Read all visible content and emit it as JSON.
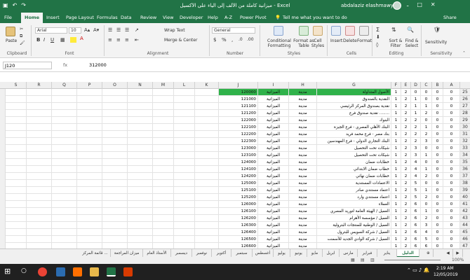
{
  "window": {
    "title": "ميزانية كاملة من الألف إلى الياء على الأكسيل  -  Excel",
    "user": "abdalaziz elashmawy",
    "controls": [
      "ـ",
      "□",
      "✕"
    ]
  },
  "menu": {
    "tabs": [
      "File",
      "Home",
      "Insert",
      "Page Layout",
      "Formulas",
      "Data",
      "Review",
      "View",
      "Developer",
      "Help",
      "A-Z",
      "Power Pivot"
    ],
    "active": "Home",
    "tell_me": "Tell me what you want to do",
    "share": "Share"
  },
  "ribbon": {
    "paste": "Paste",
    "font_name": "Arial",
    "font_size": "10",
    "wrap_text": "Wrap Text",
    "merge_center": "Merge & Center",
    "number_format": "General",
    "conditional_formatting": "Conditional Formatting",
    "format_as_table": "Format as Table",
    "cell_styles": "Cell Styles",
    "insert": "Insert",
    "delete": "Delete",
    "format": "Format",
    "sort_filter": "Sort & Filter",
    "find_select": "Find & Select",
    "sensitivity": "Sensitivity",
    "groups": [
      "Clipboard",
      "Font",
      "Alignment",
      "Number",
      "Styles",
      "Cells",
      "Editing",
      "Sensitivity"
    ]
  },
  "formula_bar": {
    "name_box": "J120",
    "fx": "fx",
    "value": "312000"
  },
  "columns": [
    "S",
    "R",
    "Q",
    "P",
    "O",
    "N",
    "M",
    "L",
    "K",
    "J",
    "I",
    "H",
    "G",
    "F",
    "E",
    "D",
    "C",
    "B",
    "A"
  ],
  "rows": [
    {
      "n": "25",
      "j": "120000",
      "i": "الميزانية",
      "h": "مدينة",
      "g": "الأصول المتداولة",
      "f": "1",
      "e": "2",
      "d": "0",
      "c": "0",
      "b": "0",
      "a": "0"
    },
    {
      "n": "26",
      "j": "121000",
      "i": "الميزانية",
      "h": "مدينة",
      "g": "النقدية بالصندوق",
      "f": "1",
      "e": "2",
      "d": "1",
      "c": "0",
      "b": "0",
      "a": "0"
    },
    {
      "n": "27",
      "j": "121100",
      "i": "الميزانية",
      "h": "مدينة",
      "g": "نقدية بصندوق المركز الرئيسي",
      "f": "1",
      "e": "2",
      "d": "1",
      "c": "1",
      "b": "0",
      "a": "0"
    },
    {
      "n": "28",
      "j": "121200",
      "i": "الميزانية",
      "h": "مدينة",
      "g": "نقدية صندوق فرع ........",
      "f": "1",
      "e": "2",
      "d": "1",
      "c": "2",
      "b": "0",
      "a": "0"
    },
    {
      "n": "29",
      "j": "122000",
      "i": "الميزانية",
      "h": "مدينة",
      "g": "البنوك",
      "f": "1",
      "e": "2",
      "d": "2",
      "c": "0",
      "b": "0",
      "a": "0"
    },
    {
      "n": "30",
      "j": "122100",
      "i": "الميزانية",
      "h": "مدينة",
      "g": "البنك الأهلي المصري - فرع الجيزة",
      "f": "1",
      "e": "2",
      "d": "2",
      "c": "1",
      "b": "0",
      "a": "0"
    },
    {
      "n": "31",
      "j": "122200",
      "i": "الميزانية",
      "h": "مدينة",
      "g": "بنك مصر - فرع محمد فريد",
      "f": "1",
      "e": "2",
      "d": "2",
      "c": "2",
      "b": "0",
      "a": "0"
    },
    {
      "n": "32",
      "j": "122300",
      "i": "الميزانية",
      "h": "مدينة",
      "g": "البنك التجاري الدولي - فرع المهندسين",
      "f": "1",
      "e": "2",
      "d": "2",
      "c": "3",
      "b": "0",
      "a": "0"
    },
    {
      "n": "33",
      "j": "123000",
      "i": "الميزانية",
      "h": "مدينة",
      "g": "شيكات تحت التحصيل",
      "f": "1",
      "e": "2",
      "d": "3",
      "c": "0",
      "b": "0",
      "a": "0"
    },
    {
      "n": "34",
      "j": "123100",
      "i": "الميزانية",
      "h": "مدينة",
      "g": "شيكات تحت التحصيل",
      "f": "1",
      "e": "2",
      "d": "3",
      "c": "1",
      "b": "0",
      "a": "0"
    },
    {
      "n": "35",
      "j": "124000",
      "i": "الميزانية",
      "h": "مدينة",
      "g": "خطابات ضمان",
      "f": "1",
      "e": "2",
      "d": "4",
      "c": "0",
      "b": "0",
      "a": "0"
    },
    {
      "n": "36",
      "j": "124100",
      "i": "الميزانية",
      "h": "مدينة",
      "g": "خطاب ضمان الابتدائي",
      "f": "1",
      "e": "2",
      "d": "4",
      "c": "1",
      "b": "0",
      "a": "0"
    },
    {
      "n": "37",
      "j": "124200",
      "i": "الميزانية",
      "h": "مدينة",
      "g": "خطابات ضمان نهائي",
      "f": "1",
      "e": "2",
      "d": "4",
      "c": "2",
      "b": "0",
      "a": "0"
    },
    {
      "n": "38",
      "j": "125000",
      "i": "الميزانية",
      "h": "مدينة",
      "g": "الاعتمادات المستندية",
      "f": "1",
      "e": "2",
      "d": "5",
      "c": "0",
      "b": "0",
      "a": "0"
    },
    {
      "n": "39",
      "j": "125100",
      "i": "الميزانية",
      "h": "مدينة",
      "g": "اعتماد مستندي صادر",
      "f": "1",
      "e": "2",
      "d": "5",
      "c": "1",
      "b": "0",
      "a": "0"
    },
    {
      "n": "40",
      "j": "125200",
      "i": "الميزانية",
      "h": "مدينة",
      "g": "اعتماد مستندي وارد",
      "f": "1",
      "e": "2",
      "d": "5",
      "c": "2",
      "b": "0",
      "a": "0"
    },
    {
      "n": "41",
      "j": "126000",
      "i": "الميزانية",
      "h": "مدينة",
      "g": "العملاء",
      "f": "1",
      "e": "2",
      "d": "6",
      "c": "0",
      "b": "0",
      "a": "0"
    },
    {
      "n": "42",
      "j": "126100",
      "i": "الميزانية",
      "h": "مدينة",
      "g": "العميل / الهيئة العامة لتوريد المصري",
      "f": "1",
      "e": "2",
      "d": "6",
      "c": "1",
      "b": "0",
      "a": "0"
    },
    {
      "n": "43",
      "j": "126200",
      "i": "الميزانية",
      "h": "مدينة",
      "g": "العميل / مؤسسة الأهرام",
      "f": "1",
      "e": "2",
      "d": "6",
      "c": "2",
      "b": "0",
      "a": "0"
    },
    {
      "n": "44",
      "j": "126300",
      "i": "الميزانية",
      "h": "مدينة",
      "g": "العميل / الوطنية للمنتجات البترولية",
      "f": "1",
      "e": "2",
      "d": "6",
      "c": "3",
      "b": "0",
      "a": "0"
    },
    {
      "n": "45",
      "j": "126400",
      "i": "الميزانية",
      "h": "مدينة",
      "g": "العميل / شركة السويس للبترول",
      "f": "1",
      "e": "2",
      "d": "6",
      "c": "4",
      "b": "0",
      "a": "0"
    },
    {
      "n": "46",
      "j": "126500",
      "i": "الميزانية",
      "h": "مدينة",
      "g": "العميل / شركة الوادي الجديد للأسمنت",
      "f": "1",
      "e": "2",
      "d": "6",
      "c": "5",
      "b": "0",
      "a": "0"
    },
    {
      "n": "47",
      "j": "126600",
      "i": "الميزانية",
      "h": "مدينة",
      "g": "",
      "f": "1",
      "e": "2",
      "d": "6",
      "c": "6",
      "b": "0",
      "a": "0"
    }
  ],
  "sheets": [
    "الدليل",
    "يناير",
    "فبراير",
    "مارس",
    "ابريل",
    "مايو",
    "يونيو",
    "يوليو",
    "أغسطس",
    "سبتمبر",
    "أكتوبر",
    "نوفمبر",
    "ديسمبر",
    "الأستاذ العام",
    "ميزان المراجعة",
    "قائمة المركز ..."
  ],
  "active_sheet": "الدليل",
  "status": {
    "zoom": "100%"
  },
  "taskbar": {
    "time": "2:19 AM",
    "date": "12/05/2019"
  },
  "colors": {
    "excel_green": "#217346",
    "selected_cell": "#2fb24a"
  }
}
